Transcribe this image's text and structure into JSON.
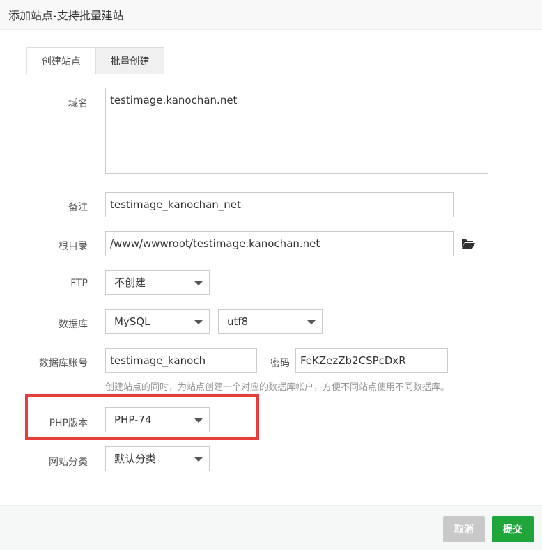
{
  "dialog": {
    "title": "添加站点-支持批量建站"
  },
  "tabs": [
    {
      "label": "创建站点",
      "active": true
    },
    {
      "label": "批量创建",
      "active": false
    }
  ],
  "form": {
    "domain": {
      "label": "域名",
      "value": "testimage.kanochan.net"
    },
    "remark": {
      "label": "备注",
      "value": "testimage_kanochan_net"
    },
    "root": {
      "label": "根目录",
      "value": "/www/wwwroot/testimage.kanochan.net",
      "icon": "folder-open-icon"
    },
    "ftp": {
      "label": "FTP",
      "selected": "不创建"
    },
    "database": {
      "label": "数据库",
      "type_selected": "MySQL",
      "charset_selected": "utf8"
    },
    "db_account": {
      "label": "数据库账号",
      "value": "testimage_kanoch",
      "password_label": "密码",
      "password_value": "FeKZezZb2CSPcDxR",
      "hint": "创建站点的同时，为站点创建一个对应的数据库帐户，方便不同站点使用不同数据库。"
    },
    "php_version": {
      "label": "PHP版本",
      "selected": "PHP-74"
    },
    "category": {
      "label": "网站分类",
      "selected": "默认分类"
    }
  },
  "footer": {
    "cancel_label": "取消",
    "submit_label": "提交"
  },
  "colors": {
    "primary_green": "#20a53a",
    "highlight_red": "#e63c3c",
    "cancel_gray": "#c9c9c9"
  }
}
